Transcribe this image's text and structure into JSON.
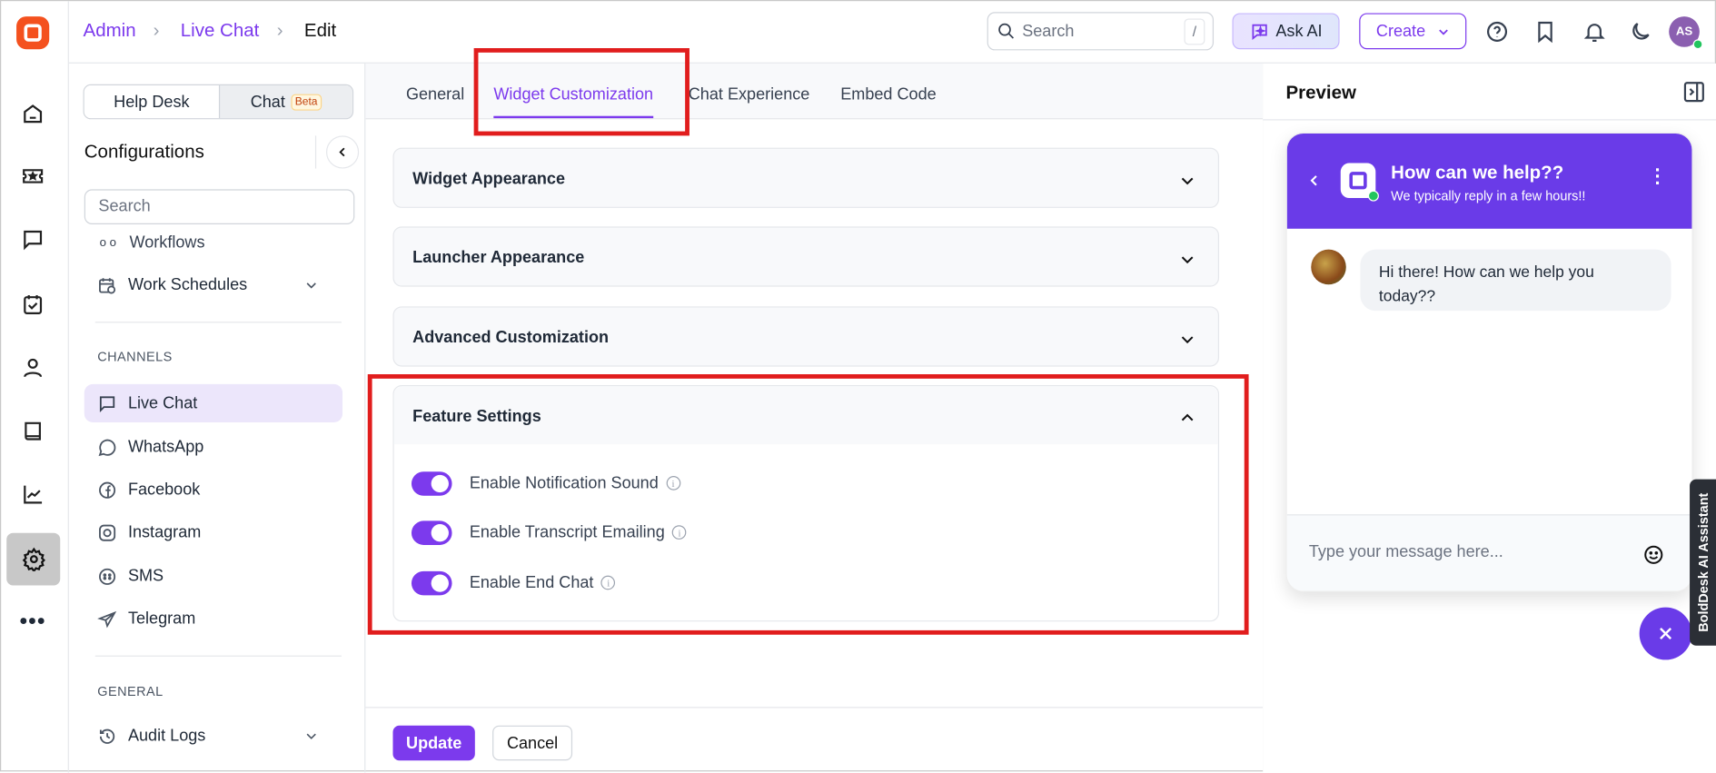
{
  "header": {
    "breadcrumb": [
      "Admin",
      "Live Chat",
      "Edit"
    ],
    "search_placeholder": "Search",
    "search_shortcut": "/",
    "ask_ai": "Ask AI",
    "create": "Create",
    "avatar_initials": "AS"
  },
  "sidebar": {
    "toggle": {
      "help_desk": "Help Desk",
      "chat": "Chat",
      "badge": "Beta"
    },
    "title": "Configurations",
    "search_placeholder": "Search",
    "items_top": [
      {
        "label": "Workflows"
      },
      {
        "label": "Work Schedules"
      }
    ],
    "channels_heading": "CHANNELS",
    "channels": [
      {
        "label": "Live Chat",
        "active": true
      },
      {
        "label": "WhatsApp"
      },
      {
        "label": "Facebook"
      },
      {
        "label": "Instagram"
      },
      {
        "label": "SMS"
      },
      {
        "label": "Telegram"
      }
    ],
    "general_heading": "GENERAL",
    "general": [
      {
        "label": "Audit Logs"
      }
    ]
  },
  "tabs": [
    {
      "label": "General"
    },
    {
      "label": "Widget Customization",
      "active": true
    },
    {
      "label": "Chat Experience"
    },
    {
      "label": "Embed Code"
    }
  ],
  "sections": [
    {
      "title": "Widget Appearance",
      "expanded": false
    },
    {
      "title": "Launcher Appearance",
      "expanded": false
    },
    {
      "title": "Advanced Customization",
      "expanded": false
    },
    {
      "title": "Feature Settings",
      "expanded": true
    }
  ],
  "features": [
    {
      "label": "Enable Notification Sound",
      "enabled": true
    },
    {
      "label": "Enable Transcript Emailing",
      "enabled": true
    },
    {
      "label": "Enable End Chat",
      "enabled": true
    }
  ],
  "footer": {
    "update": "Update",
    "cancel": "Cancel"
  },
  "preview": {
    "title": "Preview",
    "chat_title": "How can we help??",
    "chat_subtitle": "We typically reply in a few hours!!",
    "message": "Hi there! How can we help you today??",
    "input_placeholder": "Type your message here...",
    "assistant_tab": "BoldDesk AI Assistant"
  },
  "colors": {
    "accent": "#7c3aed",
    "widget_header": "#6a3be8",
    "highlight": "#e11d1d"
  }
}
